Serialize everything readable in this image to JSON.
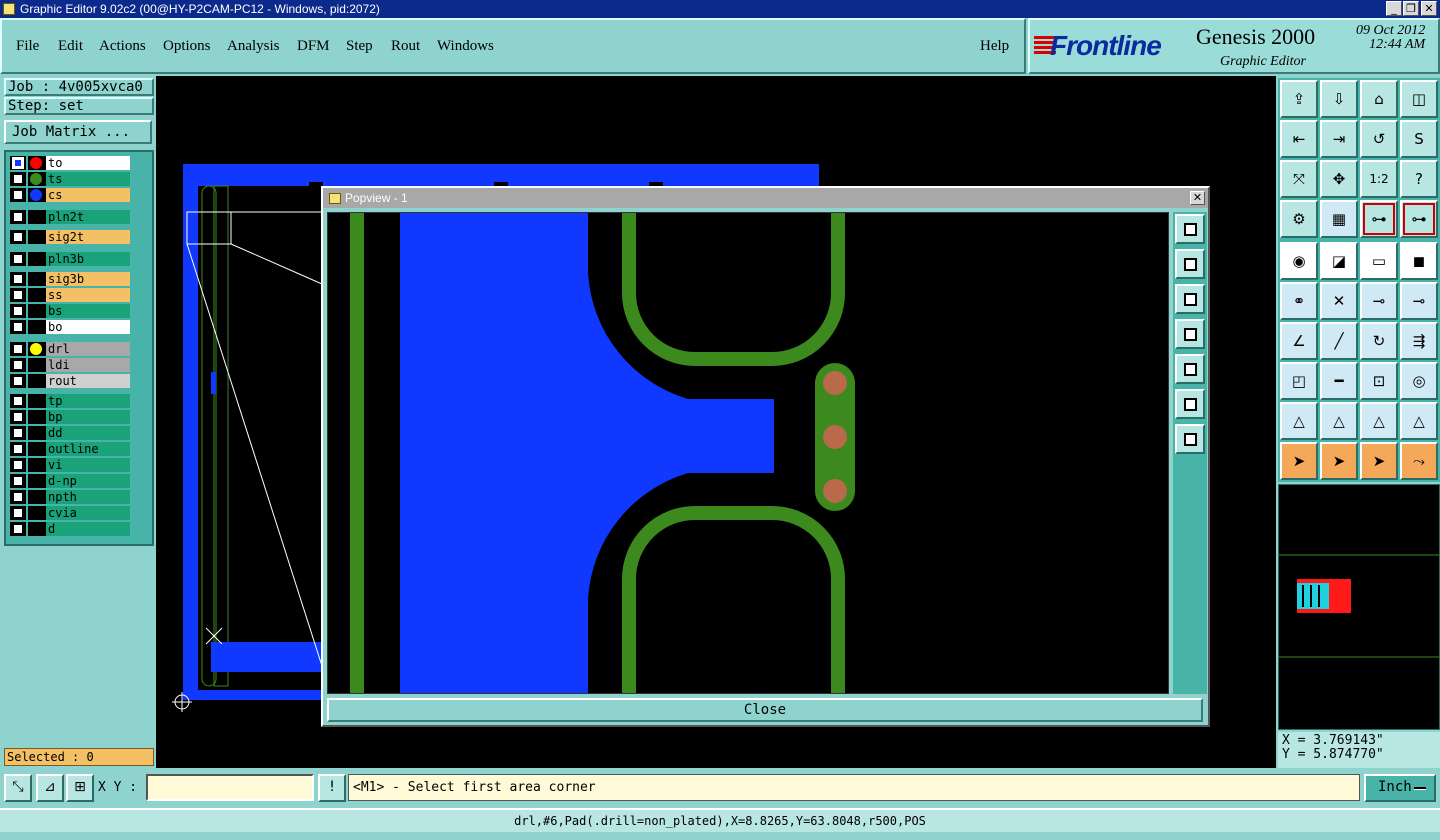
{
  "window": {
    "title": "Graphic Editor 9.02c2 (00@HY-P2CAM-PC12 - Windows, pid:2072)",
    "min_label": "_",
    "max_label": "❐",
    "close_label": "✕"
  },
  "menu": [
    "File",
    "Edit",
    "Actions",
    "Options",
    "Analysis",
    "DFM",
    "Step",
    "Rout",
    "Windows"
  ],
  "help_label": "Help",
  "brand": {
    "logo": "Frontline",
    "product": "Genesis 2000",
    "subtitle": "Graphic Editor",
    "date": "09 Oct 2012",
    "time": "12:44 AM"
  },
  "job": {
    "job_line": "Job : 4v005xvca0",
    "step_line": "Step: set",
    "matrix_button": "Job Matrix ..."
  },
  "layers": [
    {
      "name": "to",
      "color": "#ffffff",
      "dot": "#ff0000",
      "checked": true
    },
    {
      "name": "ts",
      "color": "#1aa37a",
      "dot": "#3c8a1e",
      "checked": false
    },
    {
      "name": "cs",
      "color": "#f4c065",
      "dot": "#1038ff",
      "checked": false
    },
    {
      "name": "pln2t",
      "color": "#1aa37a",
      "dot": "",
      "checked": false
    },
    {
      "name": "sig2t",
      "color": "#f4c065",
      "dot": "",
      "checked": false
    },
    {
      "name": "pln3b",
      "color": "#1aa37a",
      "dot": "",
      "checked": false
    },
    {
      "name": "sig3b",
      "color": "#f4c065",
      "dot": "",
      "checked": false
    },
    {
      "name": "ss",
      "color": "#f4c065",
      "dot": "",
      "checked": false
    },
    {
      "name": "bs",
      "color": "#1aa37a",
      "dot": "",
      "checked": false
    },
    {
      "name": "bo",
      "color": "#ffffff",
      "dot": "",
      "checked": false
    },
    {
      "name": "drl",
      "color": "#a8a8a8",
      "dot": "#ffff00",
      "checked": false
    },
    {
      "name": "ldi",
      "color": "#a8a8a8",
      "dot": "",
      "checked": false
    },
    {
      "name": "rout",
      "color": "#d0d0d0",
      "dot": "",
      "checked": false
    },
    {
      "name": "tp",
      "color": "#1aa37a",
      "dot": "",
      "checked": false
    },
    {
      "name": "bp",
      "color": "#1aa37a",
      "dot": "",
      "checked": false
    },
    {
      "name": "dd",
      "color": "#1aa37a",
      "dot": "",
      "checked": false
    },
    {
      "name": "outline",
      "color": "#1aa37a",
      "dot": "",
      "checked": false
    },
    {
      "name": "vi",
      "color": "#1aa37a",
      "dot": "",
      "checked": false
    },
    {
      "name": "d-np",
      "color": "#1aa37a",
      "dot": "",
      "checked": false
    },
    {
      "name": "npth",
      "color": "#1aa37a",
      "dot": "",
      "checked": false
    },
    {
      "name": "cvia",
      "color": "#1aa37a",
      "dot": "",
      "checked": false
    },
    {
      "name": "d",
      "color": "#1aa37a",
      "dot": "",
      "checked": false
    }
  ],
  "selected_label": "Selected : 0",
  "popview": {
    "title": "Popview - 1",
    "close_x": "✕",
    "close_button": "Close"
  },
  "coords": {
    "x_line": "X = 3.769143\"",
    "y_line": "Y = 5.874770\""
  },
  "bottom": {
    "xy_label": "X Y :",
    "xy_value": "",
    "warn_icon": "!",
    "prompt": "<M1> - Select first area corner",
    "unit": "Inch"
  },
  "status_line": "drl,#6,Pad(.drill=non_plated),X=8.8265,Y=63.8048,r500,POS",
  "colors": {
    "copper_blue": "#1038ff",
    "outline_green": "#3c8a1e",
    "pad_brown": "#b86a4a",
    "panel_teal": "#8fd3cf"
  },
  "toolbar_icons": [
    "open-job-icon",
    "close-job-icon",
    "home-icon",
    "window-icon",
    "step-in-icon",
    "step-out-icon",
    "reverse-icon",
    "s-route-icon",
    "fit-icon",
    "zoom-home-icon",
    "ratio-icon",
    "help-icon",
    "tools-icon",
    "grid-icon",
    "net-icon-1",
    "net-icon-2",
    "add-pad-icon",
    "select-region-icon",
    "ruler-icon",
    "dot-icon",
    "snap-icon",
    "cross-icon",
    "pad-pair-icon",
    "pad-move-icon",
    "angle-icon",
    "line-red-icon",
    "arc-icon",
    "stack-icon",
    "pad-square-icon",
    "line-icon",
    "measure-box-icon",
    "rings-icon",
    "tri-up-icon",
    "tri-blue-icon",
    "tri-square-icon",
    "tri-dash-icon",
    "pointer-icon",
    "pointer-box-icon",
    "pointer-boxed-icon",
    "connect-icon"
  ]
}
